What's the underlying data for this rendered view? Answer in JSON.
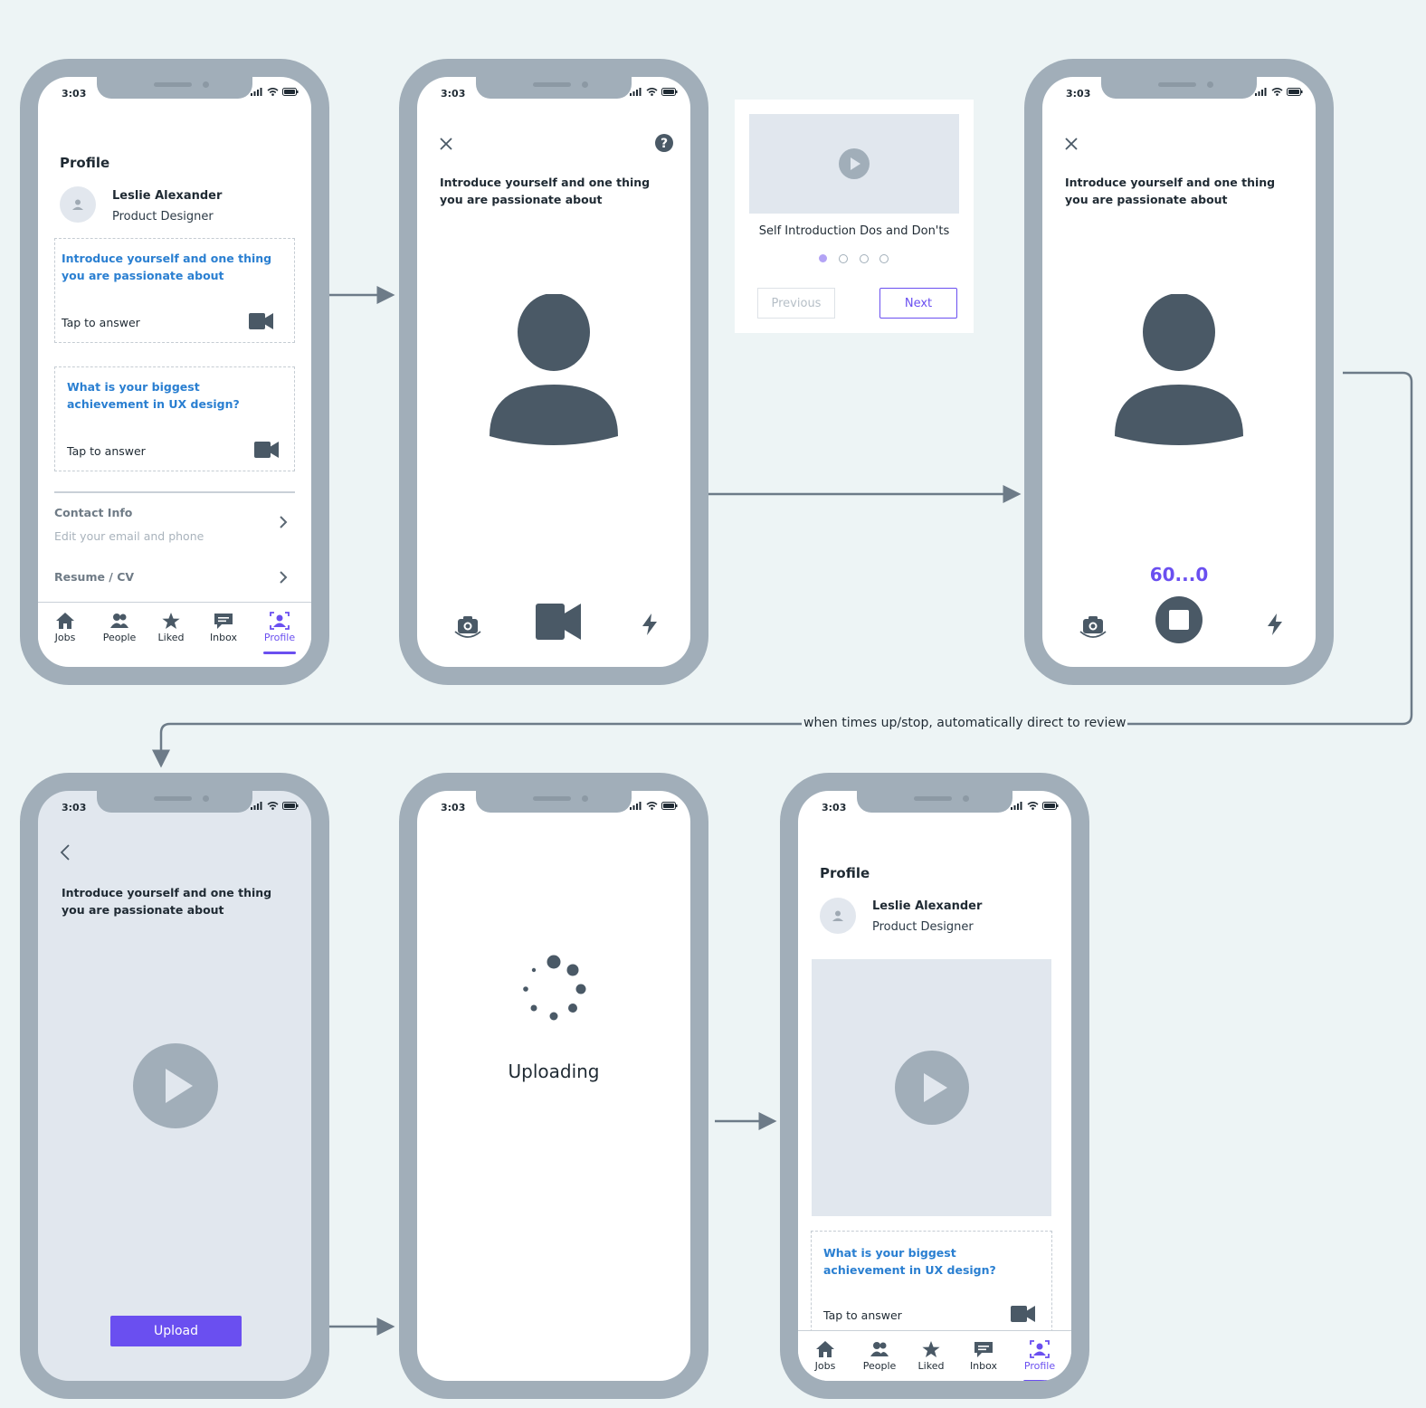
{
  "status": {
    "time": "3:03"
  },
  "screen1": {
    "title": "Profile",
    "user_name": "Leslie Alexander",
    "user_role": "Product Designer",
    "question1": "Introduce yourself and one thing you are passionate about",
    "question2": "What is your biggest achievement in UX design?",
    "tap_label": "Tap to answer",
    "contact_title": "Contact Info",
    "contact_sub": "Edit your email and phone",
    "resume_title": "Resume / CV"
  },
  "tabs": [
    {
      "label": "Jobs",
      "icon": "home-icon"
    },
    {
      "label": "People",
      "icon": "people-icon"
    },
    {
      "label": "Liked",
      "icon": "star-icon"
    },
    {
      "label": "Inbox",
      "icon": "message-icon"
    },
    {
      "label": "Profile",
      "icon": "profile-icon"
    }
  ],
  "screen2": {
    "prompt": "Introduce yourself and one thing you are passionate about"
  },
  "tips_card": {
    "caption": "Self Introduction Dos and Don'ts",
    "previous_label": "Previous",
    "next_label": "Next",
    "page_count": 4,
    "active_page": 1
  },
  "screen3": {
    "prompt": "Introduce yourself and one thing you are passionate about",
    "countdown": "60...0"
  },
  "flow_caption": "when times up/stop, automatically direct to review",
  "screen4": {
    "prompt": "Introduce yourself and one thing you are passionate about",
    "upload_label": "Upload"
  },
  "screen5": {
    "status_text": "Uploading"
  },
  "screen6": {
    "title": "Profile",
    "user_name": "Leslie Alexander",
    "user_role": "Product Designer",
    "question2": "What is your biggest achievement in UX design?",
    "tap_label": "Tap to answer"
  },
  "colors": {
    "accent": "#6a4ff0",
    "link": "#2a7fd1",
    "dark": "#4a5966",
    "frame": "#a1aeb9",
    "background": "#edf4f5"
  }
}
